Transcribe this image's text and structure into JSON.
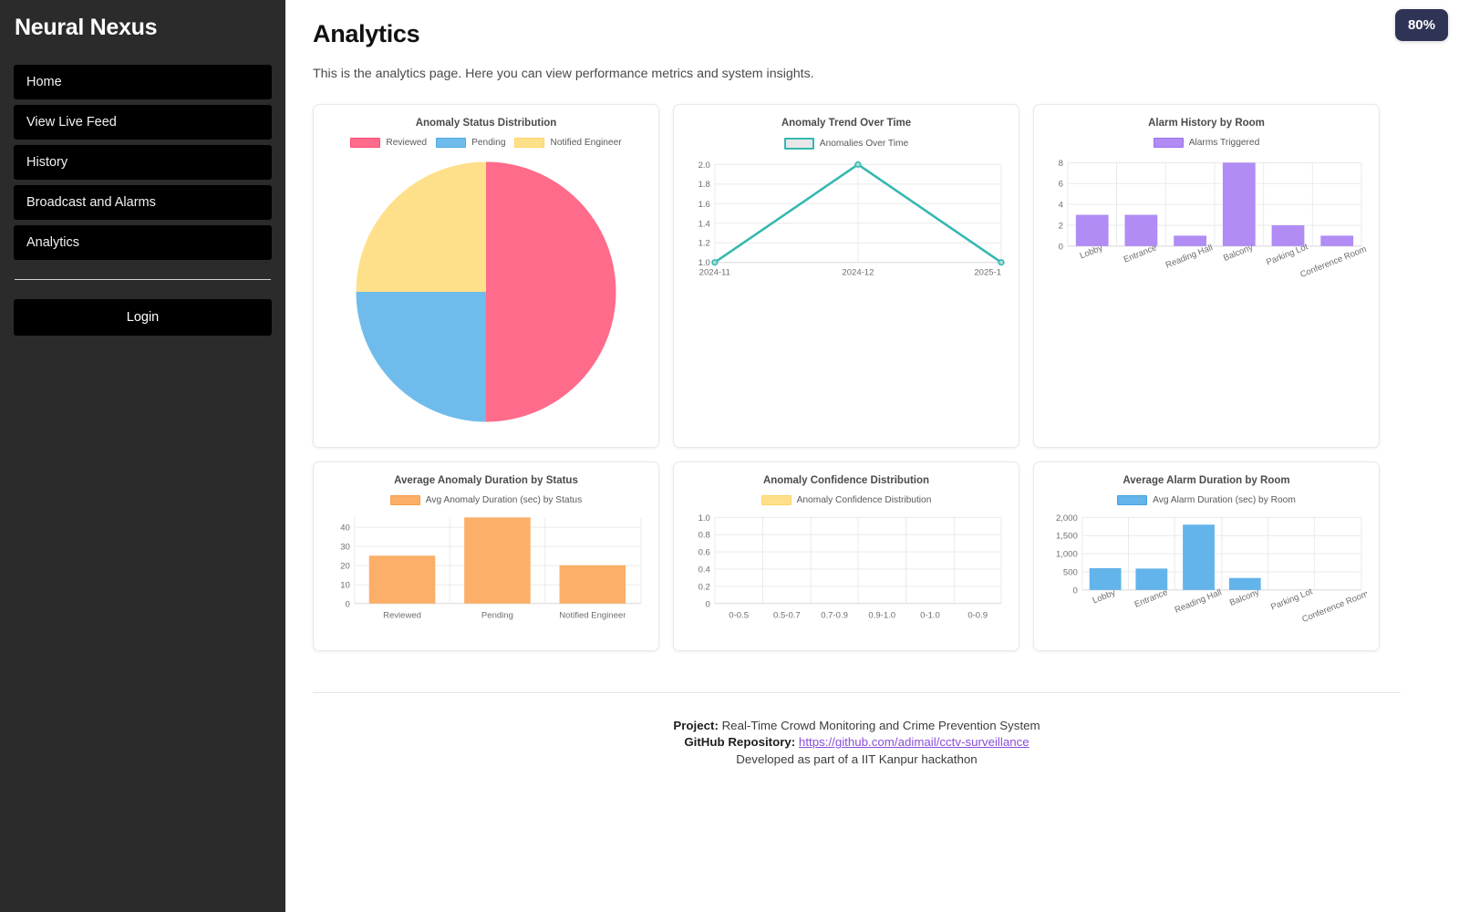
{
  "sidebar": {
    "brand": "Neural Nexus",
    "items": [
      {
        "label": "Home"
      },
      {
        "label": "View Live Feed"
      },
      {
        "label": "History"
      },
      {
        "label": "Broadcast and Alarms"
      },
      {
        "label": "Analytics"
      }
    ],
    "login_label": "Login"
  },
  "header": {
    "title": "Analytics",
    "subtitle": "This is the analytics page. Here you can view performance metrics and system insights.",
    "zoom_badge": "80%"
  },
  "footer": {
    "project_label": "Project:",
    "project_value": "Real-Time Crowd Monitoring and Crime Prevention System",
    "repo_label": "GitHub Repository:",
    "repo_url": "https://github.com/adimail/cctv-surveillance",
    "credit": "Developed as part of a IIT Kanpur hackathon"
  },
  "colors": {
    "pink": "#FF6B8A",
    "blue": "#6FBCEC",
    "yellow": "#FFE08A",
    "teal": "#35B8B0",
    "purple": "#B18CF5",
    "orange": "#FBAF68",
    "sky": "#62B4EA",
    "badge_bg": "#2F3356",
    "sidebar_bg": "#2B2B2B",
    "nav_bg": "#000000",
    "link": "#8A4FD8"
  },
  "chart_data": [
    {
      "id": "anomaly-status-distribution",
      "type": "pie",
      "title": "Anomaly Status Distribution",
      "legend_position": "top",
      "labels": [
        "Reviewed",
        "Pending",
        "Notified Engineer"
      ],
      "values": [
        50,
        25,
        25
      ],
      "colors": [
        "#FF6B8A",
        "#6FBCEC",
        "#FFE08A"
      ]
    },
    {
      "id": "anomaly-trend-over-time",
      "type": "line",
      "title": "Anomaly Trend Over Time",
      "legend_position": "top",
      "series": [
        {
          "name": "Anomalies Over Time",
          "values": [
            1.0,
            2.0,
            1.0
          ]
        }
      ],
      "categories": [
        "2024-11",
        "2024-12",
        "2025-1"
      ],
      "xlabel": "",
      "ylabel": "",
      "yticks": [
        1.0,
        1.2,
        1.4,
        1.6,
        1.8,
        2.0
      ],
      "ytick_labels": [
        "1.0",
        "1.2",
        "1.4",
        "1.6",
        "1.8",
        "2.0"
      ],
      "ylim": [
        1.0,
        2.0
      ],
      "grid": true,
      "color": "#35B8B0"
    },
    {
      "id": "alarm-history-by-room",
      "type": "bar",
      "title": "Alarm History by Room",
      "legend_position": "top",
      "legend_label": "Alarms Triggered",
      "categories": [
        "Lobby",
        "Entrance",
        "Reading Hall",
        "Balcony",
        "Parking Lot",
        "Conference Room"
      ],
      "values": [
        3,
        3,
        1,
        8,
        2,
        1
      ],
      "yticks": [
        0,
        2,
        4,
        6,
        8
      ],
      "ytick_labels": [
        "0",
        "2",
        "4",
        "6",
        "8"
      ],
      "ylim": [
        0,
        8
      ],
      "grid": true,
      "color": "#B18CF5"
    },
    {
      "id": "average-anomaly-duration-by-status",
      "type": "bar",
      "title": "Average Anomaly Duration by Status",
      "legend_position": "top",
      "legend_label": "Avg Anomaly Duration (sec) by Status",
      "categories": [
        "Reviewed",
        "Pending",
        "Notified Engineer"
      ],
      "values": [
        25,
        45,
        20
      ],
      "yticks": [
        0,
        10,
        20,
        30,
        40
      ],
      "ytick_labels": [
        "0",
        "10",
        "20",
        "30",
        "40"
      ],
      "ylim": [
        0,
        45
      ],
      "grid": true,
      "color": "#FBAF68"
    },
    {
      "id": "anomaly-confidence-distribution",
      "type": "bar",
      "title": "Anomaly Confidence Distribution",
      "legend_position": "top",
      "legend_label": "Anomaly Confidence Distribution",
      "categories": [
        "0-0.5",
        "0.5-0.7",
        "0.7-0.9",
        "0.9-1.0",
        "0-1.0",
        "0-0.9"
      ],
      "values": [
        0,
        0,
        0,
        0,
        0,
        0
      ],
      "yticks": [
        0,
        0.2,
        0.4,
        0.6,
        0.8,
        1.0
      ],
      "ytick_labels": [
        "0",
        "0.2",
        "0.4",
        "0.6",
        "0.8",
        "1.0"
      ],
      "ylim": [
        0,
        1.0
      ],
      "grid": true,
      "color": "#FFE08A"
    },
    {
      "id": "average-alarm-duration-by-room",
      "type": "bar",
      "title": "Average Alarm Duration by Room",
      "legend_position": "top",
      "legend_label": "Avg Alarm Duration (sec) by Room",
      "categories": [
        "Lobby",
        "Entrance",
        "Reading Hall",
        "Balcony",
        "Parking Lot",
        "Conference Room"
      ],
      "values": [
        600,
        590,
        1800,
        330,
        0,
        0
      ],
      "yticks": [
        0,
        500,
        1000,
        1500,
        2000
      ],
      "ytick_labels": [
        "0",
        "500",
        "1,000",
        "1,500",
        "2,000"
      ],
      "ylim": [
        0,
        2000
      ],
      "grid": true,
      "color": "#62B4EA"
    }
  ]
}
